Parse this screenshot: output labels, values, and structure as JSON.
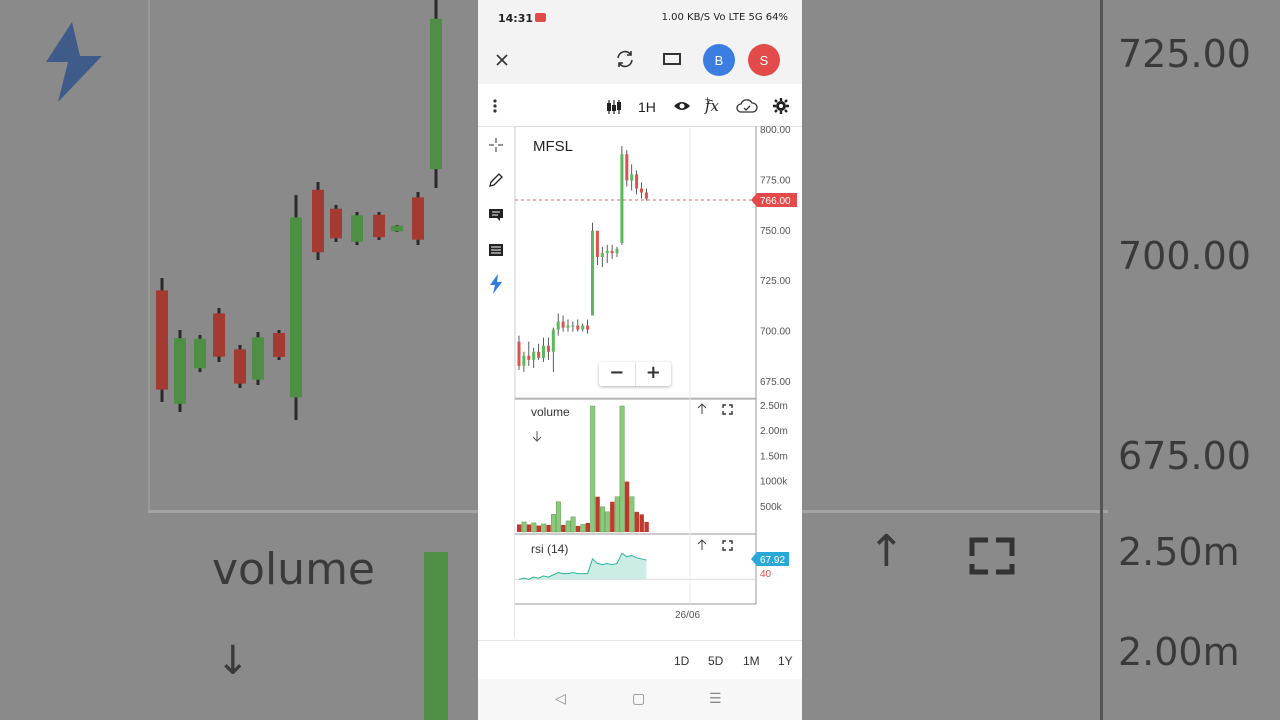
{
  "status_bar": {
    "time": "14:31",
    "indicators": "1.00 KB/S  Vo LTE  5G  64%"
  },
  "topbar": {
    "close_icon": "close-icon",
    "refresh_icon": "refresh-icon",
    "layout_icon": "rectangle-icon",
    "buy_label": "B",
    "sell_label": "S",
    "buy_color": "#3b7de0",
    "sell_color": "#e34b4b"
  },
  "toolbar": {
    "interval": "1H",
    "chart_type_icon": "candles-icon",
    "indicators_icon": "fx-icon",
    "eye_icon": "eye-icon",
    "cloud_icon": "cloud-check-icon",
    "settings_icon": "gear-icon",
    "menu_icon": "kebab-menu-icon"
  },
  "left_tools": [
    "crosshair-icon",
    "pencil-icon",
    "comment-icon",
    "list-icon",
    "lightning-icon"
  ],
  "chart": {
    "symbol": "MFSL",
    "last_price": "766.00",
    "zoom_out": "−",
    "zoom_in": "+",
    "x_tick": "26/06",
    "volume_label": "volume",
    "rsi_label": "rsi (14)",
    "rsi_value": "67.92",
    "rsi_level": "40"
  },
  "chart_data": [
    {
      "type": "candlestick",
      "series": [
        {
          "o": 695,
          "h": 698,
          "l": 681,
          "c": 683
        },
        {
          "o": 683,
          "h": 690,
          "l": 680,
          "c": 688
        },
        {
          "o": 688,
          "h": 695,
          "l": 683,
          "c": 686
        },
        {
          "o": 686,
          "h": 692,
          "l": 682,
          "c": 690
        },
        {
          "o": 690,
          "h": 694,
          "l": 686,
          "c": 687
        },
        {
          "o": 687,
          "h": 697,
          "l": 685,
          "c": 693
        },
        {
          "o": 693,
          "h": 697,
          "l": 686,
          "c": 690
        },
        {
          "o": 690,
          "h": 702,
          "l": 680,
          "c": 701
        },
        {
          "o": 701,
          "h": 709,
          "l": 698,
          "c": 705
        },
        {
          "o": 705,
          "h": 708,
          "l": 700,
          "c": 702
        },
        {
          "o": 702,
          "h": 706,
          "l": 700,
          "c": 703
        },
        {
          "o": 703,
          "h": 705,
          "l": 700,
          "c": 703
        },
        {
          "o": 703,
          "h": 706,
          "l": 700,
          "c": 701
        },
        {
          "o": 701,
          "h": 704,
          "l": 700,
          "c": 703
        },
        {
          "o": 703,
          "h": 706,
          "l": 699,
          "c": 701
        },
        {
          "o": 708,
          "h": 754,
          "l": 708,
          "c": 750
        },
        {
          "o": 750,
          "h": 750,
          "l": 733,
          "c": 737
        },
        {
          "o": 737,
          "h": 742,
          "l": 732,
          "c": 739
        },
        {
          "o": 739,
          "h": 743,
          "l": 734,
          "c": 740
        },
        {
          "o": 740,
          "h": 743,
          "l": 736,
          "c": 739
        },
        {
          "o": 739,
          "h": 742,
          "l": 737,
          "c": 741
        },
        {
          "o": 744,
          "h": 792,
          "l": 743,
          "c": 788
        },
        {
          "o": 788,
          "h": 790,
          "l": 772,
          "c": 775
        },
        {
          "o": 775,
          "h": 783,
          "l": 770,
          "c": 778
        },
        {
          "o": 778,
          "h": 780,
          "l": 768,
          "c": 771
        },
        {
          "o": 771,
          "h": 774,
          "l": 766,
          "c": 769
        },
        {
          "o": 769,
          "h": 771,
          "l": 765,
          "c": 766
        }
      ],
      "ylim": [
        675,
        800
      ],
      "yticks": [
        "800.00",
        "775.00",
        "750.00",
        "725.00",
        "700.00",
        "675.00"
      ]
    },
    {
      "type": "bar",
      "name": "volume",
      "values": [
        150,
        200,
        150,
        180,
        130,
        160,
        140,
        350,
        600,
        140,
        220,
        300,
        120,
        150,
        180,
        2500,
        700,
        500,
        400,
        600,
        700,
        2500,
        1000,
        700,
        400,
        350,
        200
      ],
      "ylim": [
        0,
        2500
      ],
      "yticks": [
        "2.50m",
        "2.00m",
        "1.50m",
        "1000k",
        "500k"
      ]
    },
    {
      "type": "line",
      "name": "rsi (14)",
      "values": [
        40,
        41,
        40,
        42,
        41,
        43,
        42,
        44,
        46,
        45,
        45,
        46,
        45,
        45,
        45,
        58,
        54,
        53,
        54,
        53,
        54,
        63,
        60,
        61,
        59,
        58,
        57
      ],
      "ylim": [
        20,
        80
      ]
    }
  ],
  "bottom": {
    "ranges": [
      "1D",
      "5D",
      "1M",
      "1Y"
    ]
  },
  "nav": {
    "back": "◁",
    "home": "▢",
    "menu": "☰"
  },
  "background": {
    "labels": [
      "725.00",
      "700.00",
      "675.00",
      "2.50m",
      "2.00m",
      "volume"
    ]
  }
}
